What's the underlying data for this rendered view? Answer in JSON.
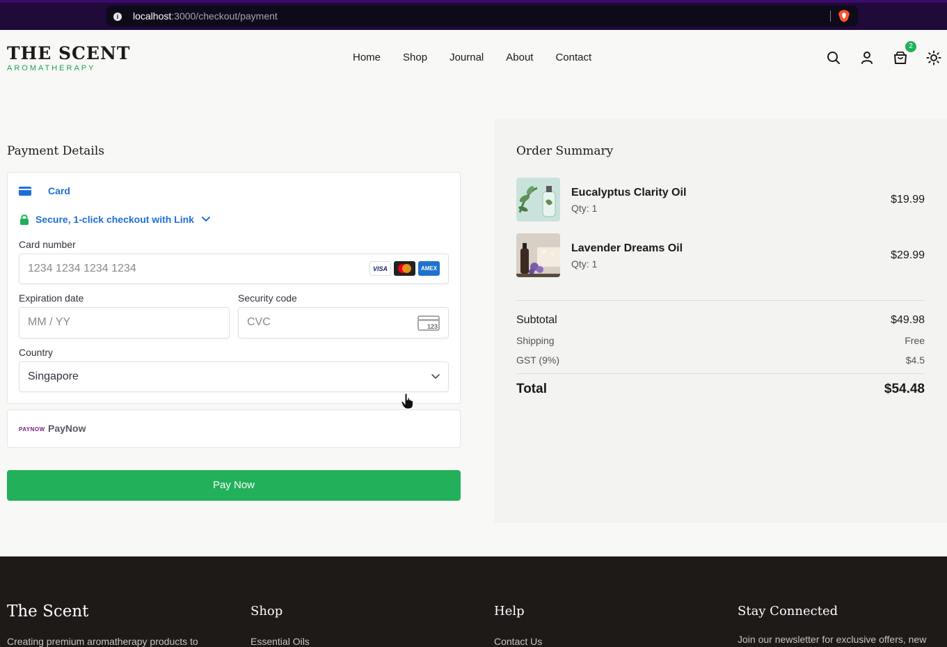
{
  "browser": {
    "url_host": "localhost",
    "url_path": ":3000/checkout/payment"
  },
  "header": {
    "logo_title": "THE SCENT",
    "logo_subtitle": "AROMATHERAPY",
    "nav": [
      "Home",
      "Shop",
      "Journal",
      "About",
      "Contact"
    ],
    "cart_count": "2"
  },
  "payment": {
    "title": "Payment Details",
    "card_tab": "Card",
    "link_label": "Secure, 1-click checkout with Link",
    "card_number_label": "Card number",
    "card_number_placeholder": "1234 1234 1234 1234",
    "card_brands": [
      "VISA",
      "MC",
      "AMEX"
    ],
    "expiry_label": "Expiration date",
    "expiry_placeholder": "MM / YY",
    "cvc_label": "Security code",
    "cvc_placeholder": "CVC",
    "cvc_icon_text": "123",
    "country_label": "Country",
    "country_value": "Singapore",
    "paynow_logo": "PAYNOW",
    "paynow_label": "PayNow",
    "pay_button": "Pay Now"
  },
  "summary": {
    "title": "Order Summary",
    "items": [
      {
        "name": "Eucalyptus Clarity Oil",
        "qty": "Qty: 1",
        "price": "$19.99"
      },
      {
        "name": "Lavender Dreams Oil",
        "qty": "Qty: 1",
        "price": "$29.99"
      }
    ],
    "subtotal_label": "Subtotal",
    "subtotal_value": "$49.98",
    "shipping_label": "Shipping",
    "shipping_value": "Free",
    "gst_label": "GST (9%)",
    "gst_value": "$4.5",
    "total_label": "Total",
    "total_value": "$54.48"
  },
  "footer": {
    "brand_title": "The Scent",
    "brand_text": "Creating premium aromatherapy products to",
    "shop_title": "Shop",
    "shop_link": "Essential Oils",
    "help_title": "Help",
    "help_link": "Contact Us",
    "connect_title": "Stay Connected",
    "connect_text": "Join our newsletter for exclusive offers, new"
  },
  "colors": {
    "accent_green": "#22b05a",
    "link_blue": "#1d6fd6",
    "footer_bg": "#1e1a18"
  }
}
